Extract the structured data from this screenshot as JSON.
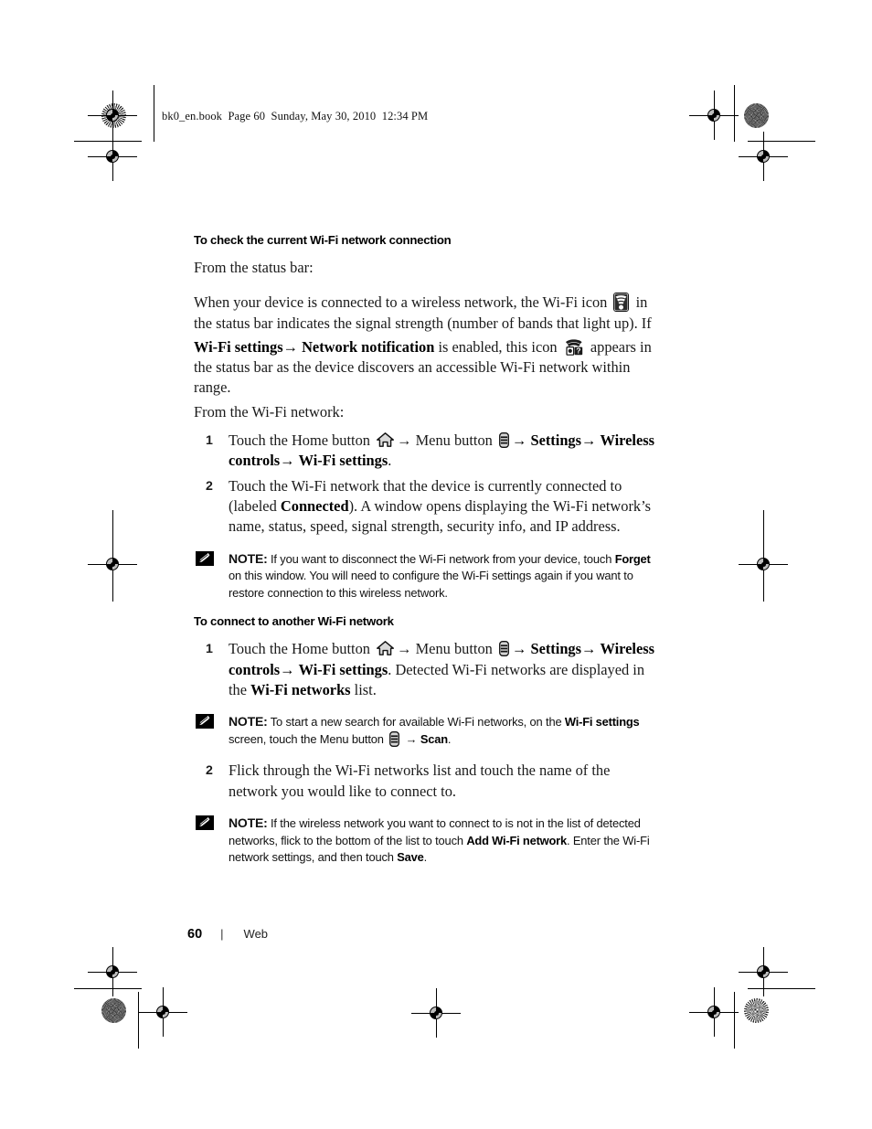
{
  "document": {
    "running_header": "bk0_en.book  Page 60  Sunday, May 30, 2010  12:34 PM",
    "footer": {
      "page_number": "60",
      "separator": "|",
      "chapter": "Web"
    }
  },
  "sections": [
    {
      "heading": "To check the current Wi-Fi network connection",
      "intro": "From the status bar:",
      "paragraph1_part1": "When your device is connected to a wireless network, the Wi-Fi icon",
      "paragraph1_part2": "in the status bar indicates the signal strength (number of bands that light up). If",
      "paragraph2_bold1": "Wi-Fi settings",
      "paragraph2_arrow1": "→",
      "paragraph2_bold2": "Network notification",
      "paragraph2_mid": "is enabled, this icon",
      "paragraph2_end": "appears in the status bar as the device discovers an accessible Wi-Fi network within range.",
      "intro2": "From the Wi-Fi network:",
      "steps": [
        {
          "num": "1",
          "t1": "Touch the Home button",
          "t2": "Menu button",
          "b1": "Settings",
          "b2": "Wireless controls",
          "b3": "Wi-Fi settings",
          "t3": "."
        },
        {
          "num": "2",
          "t1": "Touch the Wi-Fi network that the device is currently connected to (labeled",
          "b1": "Connected",
          "t2": "). A window opens displaying the Wi-Fi network’s name, status, speed, signal strength, security info, and IP address."
        }
      ],
      "note": {
        "label": "NOTE:",
        "t1": "If you want to disconnect the Wi-Fi network from your device, touch",
        "b1": "Forget",
        "t2": "on this window. You will need to configure the Wi-Fi settings again if you want to restore connection to this wireless network."
      }
    },
    {
      "heading": "To connect to another Wi-Fi network",
      "steps": [
        {
          "num": "1",
          "t1": "Touch the Home button",
          "t2": "Menu button",
          "b1": "Settings",
          "b2": "Wireless controls",
          "b3": "Wi-Fi settings",
          "t3": ". Detected Wi-Fi networks are displayed in the",
          "b4": "Wi-Fi networks",
          "t4": "list."
        },
        {
          "num": "2",
          "t1": "Flick through the Wi-Fi networks list and touch the name of the network you would like to connect to."
        }
      ],
      "note1": {
        "label": "NOTE:",
        "t1": "To start a new search for available Wi-Fi networks, on the",
        "b1": "Wi-Fi settings",
        "t2": "screen, touch the Menu button",
        "arrow": "→",
        "b2": "Scan",
        "t3": "."
      },
      "note2": {
        "label": "NOTE:",
        "t1": "If the wireless network you want to connect to is not in the list of detected networks, flick to the bottom of the list to touch",
        "b1": "Add Wi-Fi network",
        "t2": ". Enter the Wi-Fi network settings, and then touch",
        "b2": "Save",
        "t3": "."
      }
    }
  ],
  "icons": {
    "wifi": "wifi-signal-icon",
    "wifi_notification": "wifi-question-notification-icon",
    "home": "home-button-icon",
    "menu": "menu-button-icon",
    "note": "note-pencil-icon"
  },
  "colors": {
    "page_background": "#ffffff",
    "text": "#1a1a1a",
    "heading": "#000000",
    "marks": "#000000"
  },
  "arrow_glyph": "→"
}
